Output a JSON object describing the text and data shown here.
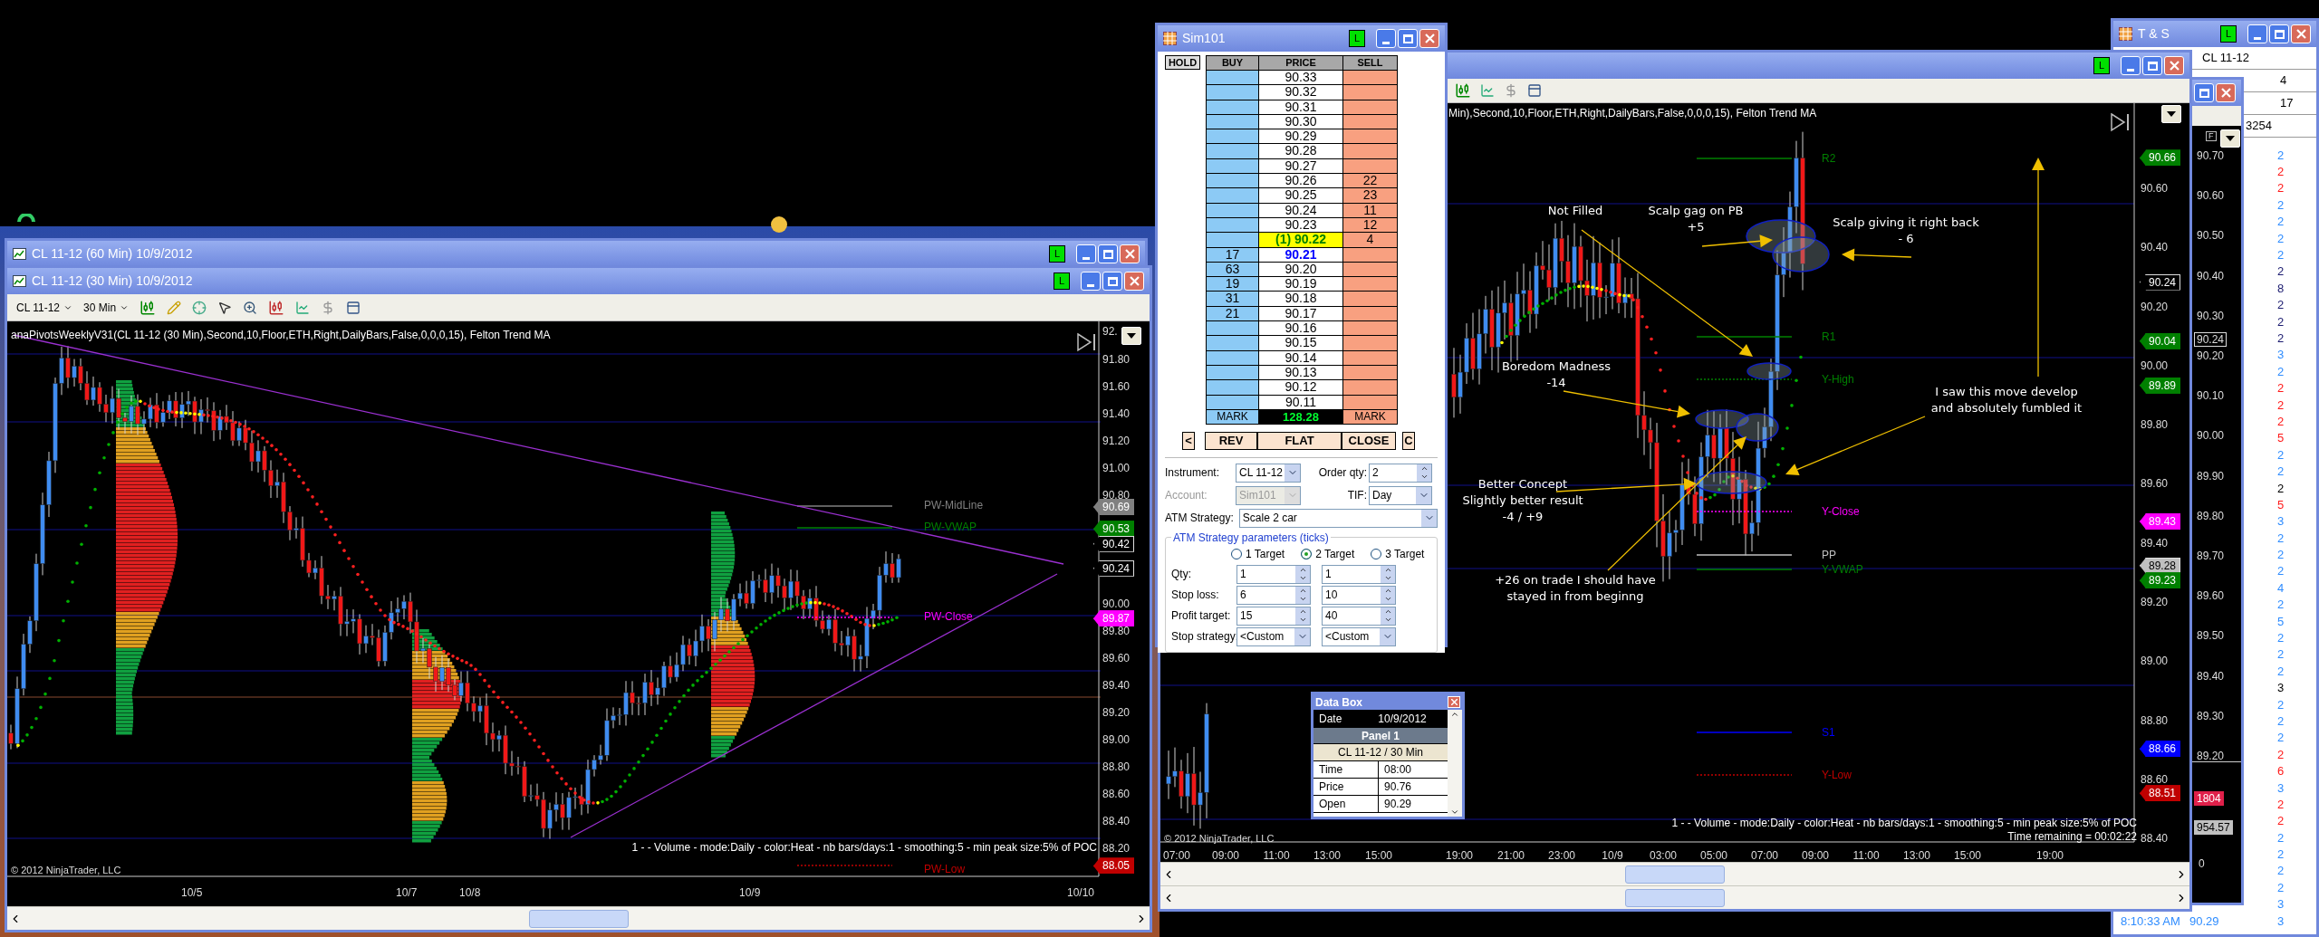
{
  "back_chart": {
    "title": "CL 11-12 (60 Min)  10/9/2012",
    "badge": "L"
  },
  "left_chart": {
    "title": "CL 11-12 (30 Min)  10/9/2012",
    "badge": "L",
    "instrument": "CL 11-12",
    "interval": "30 Min",
    "caption": "anaPivotsWeeklyV31(CL 11-12 (30 Min),Second,10,Floor,ETH,Right,DailyBars,False,0,0,0,15), Felton Trend MA",
    "price_axis": [
      "92.",
      "91.80",
      "91.60",
      "91.40",
      "91.20",
      "91.00",
      "90.80",
      "90.00",
      "89.80",
      "89.60",
      "89.40",
      "89.20",
      "89.00",
      "88.80",
      "88.60",
      "88.40",
      "88.20"
    ],
    "price_tags": [
      {
        "text": "90.69",
        "color": "#808080"
      },
      {
        "text": "90.53",
        "color": "#008000"
      },
      {
        "text": "90.42",
        "color": "#000000"
      },
      {
        "text": "90.24",
        "color": "#000000"
      },
      {
        "text": "89.87",
        "color": "#ff00ff"
      },
      {
        "text": "88.05",
        "color": "#c00000"
      }
    ],
    "levels": [
      {
        "label": "PW-MidLine",
        "color": "#808080"
      },
      {
        "label": "PW-VWAP",
        "color": "#008000"
      },
      {
        "label": "PW-Close",
        "color": "#ff00ff"
      },
      {
        "label": "PW-Low",
        "color": "#c00000"
      }
    ],
    "volume_caption": "1 -  - Volume - mode:Daily - color:Heat - nb bars/days:1 - smoothing:5 - min peak size:5% of POC",
    "copyright": "© 2012 NinjaTrader, LLC",
    "time_axis": [
      "10/5",
      "10/7",
      "10/8",
      "10/9",
      "10/10"
    ]
  },
  "right_chart": {
    "badge": "L",
    "caption": "Min),Second,10,Floor,ETH,Right,DailyBars,False,0,0,0,15), Felton Trend MA",
    "price_axis": [
      "90.60",
      "90.40",
      "90.20",
      "90.00",
      "89.80",
      "89.60",
      "89.40",
      "89.20",
      "89.00",
      "88.80",
      "88.60",
      "88.40"
    ],
    "price_tags": [
      {
        "text": "90.66",
        "color": "#008000"
      },
      {
        "text": "90.24",
        "color": "#000000"
      },
      {
        "text": "90.04",
        "color": "#008000"
      },
      {
        "text": "89.89",
        "color": "#008000"
      },
      {
        "text": "89.43",
        "color": "#ff00ff"
      },
      {
        "text": "89.28",
        "color": "#c0c0c0"
      },
      {
        "text": "89.23",
        "color": "#008000"
      },
      {
        "text": "88.66",
        "color": "#0000ff"
      },
      {
        "text": "88.51",
        "color": "#c00000"
      }
    ],
    "levels": [
      {
        "label": "R2",
        "color": "#008000"
      },
      {
        "label": "R1",
        "color": "#008000"
      },
      {
        "label": "Y-High",
        "color": "#008000"
      },
      {
        "label": "Y-Close",
        "color": "#ff00ff"
      },
      {
        "label": "PP",
        "color": "#c0c0c0"
      },
      {
        "label": "Y-VWAP",
        "color": "#008000"
      },
      {
        "label": "S1",
        "color": "#0000ff"
      },
      {
        "label": "Y-Low",
        "color": "#c00000"
      }
    ],
    "annotations": [
      "Not Filled",
      "Scalp gag on PB\n+5",
      "Scalp giving it right back\n- 6",
      "Boredom Madness\n-14",
      "I saw this move develop\nand absolutely fumbled it",
      "Better Concept\nSlightly better result\n-4 / +9",
      "+26 on trade I should have\nstayed in from beginng"
    ],
    "volume_caption": "1 -  - Volume - mode:Daily - color:Heat - nb bars/days:1 - smoothing:5 - min peak size:5% of POC",
    "time_remaining": "Time remaining = 00:02:22",
    "copyright": "© 2012 NinjaTrader, LLC",
    "time_axis": [
      "07:00",
      "09:00",
      "11:00",
      "13:00",
      "15:00",
      "19:00",
      "21:00",
      "23:00",
      "10/9",
      "03:00",
      "05:00",
      "07:00",
      "09:00",
      "11:00",
      "13:00",
      "15:00",
      "19:00"
    ]
  },
  "dom": {
    "title": "Sim101",
    "badge": "L",
    "hold": "HOLD",
    "headers": [
      "BUY",
      "PRICE",
      "SELL"
    ],
    "rows": [
      {
        "price": "90.33",
        "kind": "normal"
      },
      {
        "price": "90.32",
        "kind": "normal"
      },
      {
        "price": "90.31",
        "kind": "normal"
      },
      {
        "price": "90.30",
        "kind": "normal"
      },
      {
        "price": "90.29",
        "kind": "normal"
      },
      {
        "price": "90.28",
        "kind": "normal"
      },
      {
        "price": "90.27",
        "kind": "normal"
      },
      {
        "price": "90.26",
        "sell": "22",
        "kind": "normal"
      },
      {
        "price": "90.25",
        "sell": "23",
        "kind": "normal"
      },
      {
        "price": "90.24",
        "sell": "11",
        "kind": "normal"
      },
      {
        "price": "90.23",
        "sell": "12",
        "kind": "normal"
      },
      {
        "price": "(1) 90.22",
        "sell": "4",
        "kind": "position"
      },
      {
        "price": "90.21",
        "buy": "17",
        "kind": "last"
      },
      {
        "price": "90.20",
        "buy": "63",
        "kind": "normal"
      },
      {
        "price": "90.19",
        "buy": "19",
        "kind": "normal"
      },
      {
        "price": "90.18",
        "buy": "31",
        "kind": "normal"
      },
      {
        "price": "90.17",
        "buy": "21",
        "kind": "normal"
      },
      {
        "price": "90.16",
        "kind": "normal"
      },
      {
        "price": "90.15",
        "kind": "normal"
      },
      {
        "price": "90.14",
        "kind": "normal"
      },
      {
        "price": "90.13",
        "kind": "normal"
      },
      {
        "price": "90.12",
        "kind": "normal"
      },
      {
        "price": "90.11",
        "kind": "normal"
      }
    ],
    "footer": {
      "left": "MARK",
      "pnl": "128.28",
      "right": "MARK"
    },
    "buttons": [
      "<",
      "REV",
      "FLAT",
      "CLOSE",
      "C"
    ],
    "fields": [
      {
        "label": "Instrument:",
        "value": "CL 11-12",
        "kind": "dropdown",
        "disabled": false
      },
      {
        "label": "Order qty:",
        "value": "2",
        "kind": "spinner",
        "disabled": false
      },
      {
        "label": "Account:",
        "value": "Sim101",
        "kind": "dropdown",
        "disabled": true
      },
      {
        "label": "TIF:",
        "value": "Day",
        "kind": "dropdown",
        "disabled": false
      },
      {
        "label": "ATM Strategy:",
        "value": "Scale 2 car",
        "kind": "dropdown",
        "disabled": false
      }
    ],
    "atm": {
      "title": "ATM Strategy parameters (ticks)",
      "targets": [
        {
          "label": "1 Target",
          "selected": false
        },
        {
          "label": "2 Target",
          "selected": true
        },
        {
          "label": "3 Target",
          "selected": false
        }
      ],
      "rows": [
        {
          "label": "Qty:",
          "values": [
            "1",
            "1"
          ],
          "kind": "spinner"
        },
        {
          "label": "Stop loss:",
          "values": [
            "6",
            "10"
          ],
          "kind": "spinner"
        },
        {
          "label": "Profit target:",
          "values": [
            "15",
            "40"
          ],
          "kind": "spinner"
        },
        {
          "label": "Stop strategy:",
          "values": [
            "<Custom",
            "<Custom"
          ],
          "kind": "dropdown"
        }
      ]
    }
  },
  "data_box": {
    "title": "Data Box",
    "date_label": "Date",
    "date": "10/9/2012",
    "panel": "Panel 1",
    "series": "CL 11-12 / 30 Min",
    "rows": [
      {
        "label": "Time",
        "value": "08:00"
      },
      {
        "label": "Price",
        "value": "90.76"
      },
      {
        "label": "Open",
        "value": "90.29"
      }
    ]
  },
  "middle_chart": {
    "flag": "F",
    "price_axis": [
      "90.70",
      "90.60",
      "90.50",
      "90.40",
      "90.30",
      "90.20",
      "90.10",
      "90.00",
      "89.90",
      "89.80",
      "89.70",
      "89.60",
      "89.50",
      "89.40",
      "89.30",
      "89.20"
    ],
    "price_tag": "90.24",
    "volume_tags": [
      {
        "text": "1804",
        "color": "#e0204a"
      },
      {
        "text": "954.57",
        "color": "#c0c0c0"
      }
    ],
    "volume_axis": "0"
  },
  "time_sales": {
    "title": "T & S",
    "badge": "L",
    "header": [
      "CL 11-12",
      "4",
      "17",
      "3254"
    ],
    "trades": [
      {
        "size": "2",
        "color": "#2e8cff"
      },
      {
        "size": "2",
        "color": "#ff1a1a"
      },
      {
        "size": "2",
        "color": "#ff1a1a"
      },
      {
        "size": "2",
        "color": "#2e8cff"
      },
      {
        "size": "2",
        "color": "#2e8cff"
      },
      {
        "size": "2",
        "color": "#2e8cff"
      },
      {
        "size": "2",
        "color": "#2e8cff"
      },
      {
        "size": "2",
        "color": "#1c1c70"
      },
      {
        "size": "8",
        "color": "#1c1c70"
      },
      {
        "size": "2",
        "color": "#1c1c70"
      },
      {
        "size": "2",
        "color": "#1c1c70"
      },
      {
        "size": "2",
        "color": "#1c1c70"
      },
      {
        "size": "3",
        "color": "#2e8cff"
      },
      {
        "size": "2",
        "color": "#2e8cff"
      },
      {
        "size": "2",
        "color": "#ff1a1a"
      },
      {
        "size": "2",
        "color": "#ff1a1a"
      },
      {
        "size": "2",
        "color": "#ff1a1a"
      },
      {
        "size": "5",
        "color": "#ff1a1a"
      },
      {
        "size": "2",
        "color": "#2e8cff"
      },
      {
        "size": "2",
        "color": "#2e8cff"
      },
      {
        "size": "2",
        "color": "#000000"
      },
      {
        "size": "5",
        "color": "#ff1a1a"
      },
      {
        "size": "3",
        "color": "#2e8cff"
      },
      {
        "size": "2",
        "color": "#2e8cff"
      },
      {
        "size": "2",
        "color": "#2e8cff"
      },
      {
        "size": "2",
        "color": "#2e8cff"
      },
      {
        "size": "4",
        "color": "#2e8cff"
      },
      {
        "size": "2",
        "color": "#2e8cff"
      },
      {
        "size": "5",
        "color": "#2e8cff"
      },
      {
        "size": "2",
        "color": "#2e8cff"
      },
      {
        "size": "2",
        "color": "#2e8cff"
      },
      {
        "size": "2",
        "color": "#2e8cff"
      },
      {
        "size": "3",
        "color": "#000000"
      },
      {
        "size": "2",
        "color": "#2e8cff"
      },
      {
        "size": "2",
        "color": "#2e8cff"
      },
      {
        "size": "2",
        "color": "#2e8cff"
      },
      {
        "size": "2",
        "color": "#ff1a1a"
      },
      {
        "size": "6",
        "color": "#ff1a1a"
      },
      {
        "size": "3",
        "color": "#2e8cff"
      },
      {
        "size": "2",
        "color": "#ff1a1a"
      },
      {
        "size": "2",
        "color": "#ff1a1a"
      },
      {
        "size": "2",
        "color": "#2e8cff"
      },
      {
        "size": "2",
        "color": "#2e8cff"
      },
      {
        "size": "2",
        "color": "#2e8cff"
      },
      {
        "size": "2",
        "color": "#2e8cff"
      },
      {
        "size": "3",
        "color": "#2e8cff"
      },
      {
        "time": "8:10:33 AM",
        "price": "90.29",
        "size": "3",
        "color": "#2e8cff"
      }
    ]
  }
}
